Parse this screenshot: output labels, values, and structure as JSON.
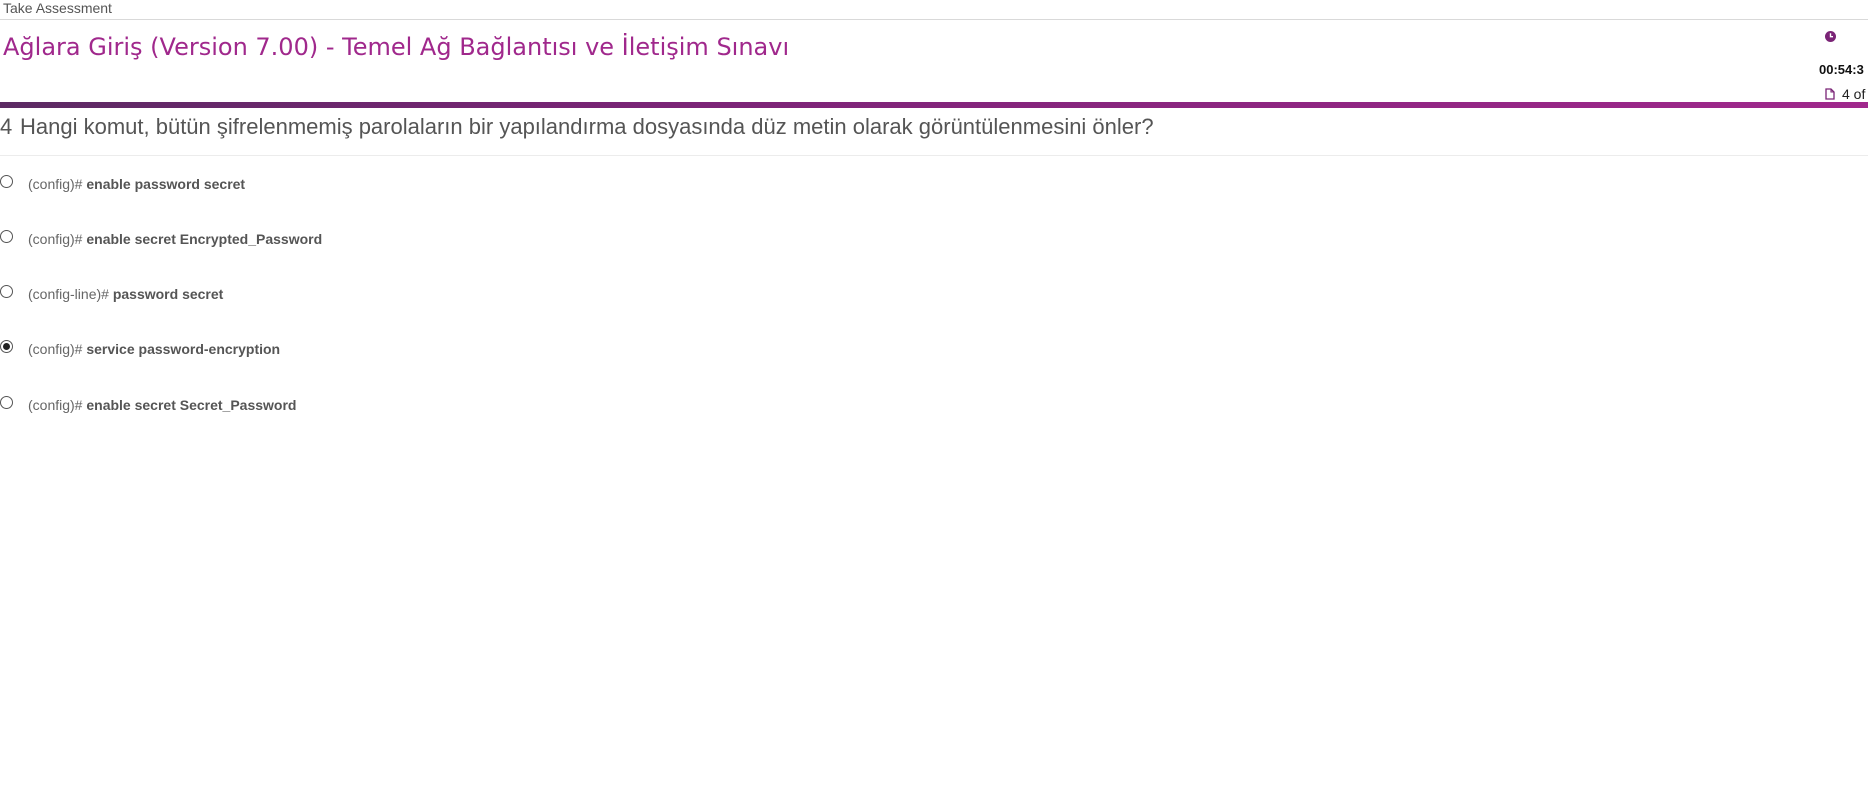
{
  "topbar": {
    "label": "Take Assessment"
  },
  "header": {
    "title": "Ağlara Giriş (Version 7.00) - Temel Ağ Bağlantısı ve İletişim Sınavı",
    "timer": "00:54:3",
    "progress": "4 of",
    "icons": {
      "clock": "clock-icon",
      "document": "document-icon"
    }
  },
  "colors": {
    "brand": "#a0288c",
    "accent_bar_start": "#5c2a63",
    "accent_bar_end": "#a0288c"
  },
  "question": {
    "number": "4",
    "text": "Hangi komut, bütün şifrelenmemiş parolaların bir yapılandırma dosyasında düz metin olarak görüntülenmesini önler?"
  },
  "options": [
    {
      "prefix": "(config)# ",
      "command": "enable password secret",
      "selected": false
    },
    {
      "prefix": "(config)# ",
      "command": "enable secret Encrypted_Password",
      "selected": false
    },
    {
      "prefix": "(config-line)# ",
      "command": "password secret",
      "selected": false
    },
    {
      "prefix": "(config)# ",
      "command": "service password-encryption",
      "selected": true
    },
    {
      "prefix": "(config)# ",
      "command": "enable secret Secret_Password",
      "selected": false
    }
  ]
}
